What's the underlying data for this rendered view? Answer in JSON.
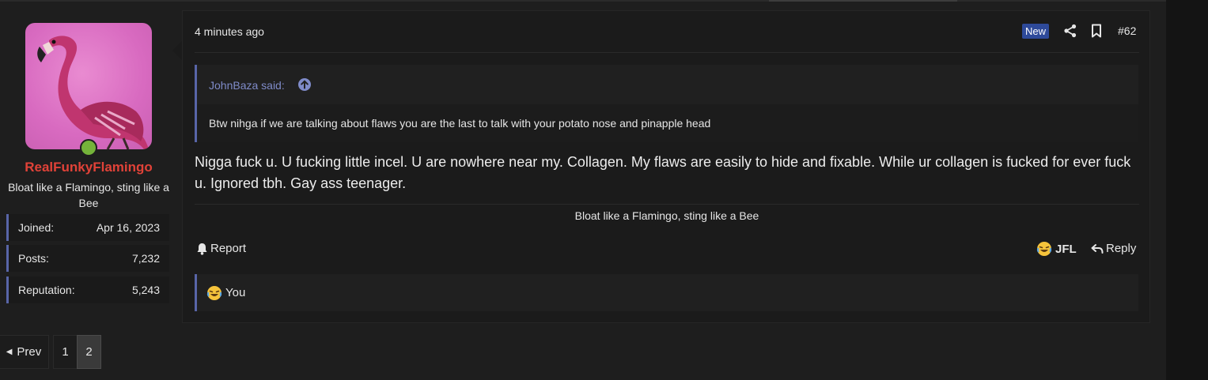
{
  "post": {
    "time": "4 minutes ago",
    "badge": "New",
    "number": "#62",
    "user": {
      "name": "RealFunkyFlamingo",
      "title": "Bloat like a Flamingo, sting like a Bee",
      "stats": [
        {
          "label": "Joined:",
          "value": "Apr 16, 2023"
        },
        {
          "label": "Posts:",
          "value": "7,232"
        },
        {
          "label": "Reputation:",
          "value": "5,243"
        }
      ]
    },
    "quote": {
      "author": "JohnBaza said:",
      "text": "Btw nihga if we are talking about flaws you are the last to talk with your potato nose and pinapple head"
    },
    "message": "Nigga fuck u. U fucking little incel. U are nowhere near my. Collagen. My flaws are easily to hide and fixable. While ur collagen is fucked for ever fuck u. Ignored tbh. Gay ass teenager.",
    "signature": "Bloat like a Flamingo, sting like a Bee",
    "actions": {
      "report": "Report",
      "reaction": "JFL",
      "reply": "Reply"
    },
    "reactions_summary": "You"
  },
  "pagination": {
    "prev": "Prev",
    "pages": [
      "1",
      "2"
    ],
    "current": "2"
  },
  "colors": {
    "username": "#e14238",
    "accent": "#5865a8",
    "badge": "#2e4a9a",
    "online": "#75b33a"
  }
}
